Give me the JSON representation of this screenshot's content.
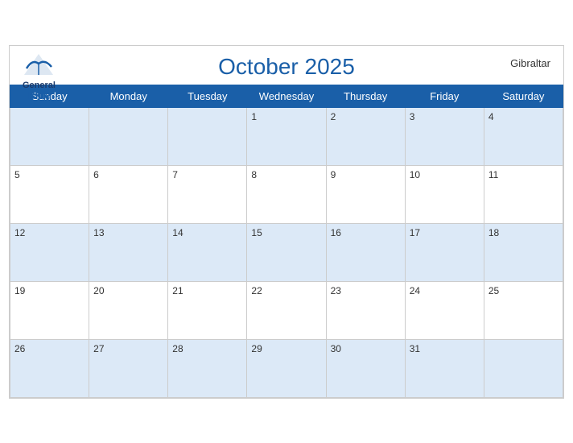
{
  "header": {
    "title": "October 2025",
    "country": "Gibraltar",
    "logo_general": "General",
    "logo_blue": "Blue"
  },
  "weekdays": [
    "Sunday",
    "Monday",
    "Tuesday",
    "Wednesday",
    "Thursday",
    "Friday",
    "Saturday"
  ],
  "weeks": [
    [
      "",
      "",
      "",
      "1",
      "2",
      "3",
      "4"
    ],
    [
      "5",
      "6",
      "7",
      "8",
      "9",
      "10",
      "11"
    ],
    [
      "12",
      "13",
      "14",
      "15",
      "16",
      "17",
      "18"
    ],
    [
      "19",
      "20",
      "21",
      "22",
      "23",
      "24",
      "25"
    ],
    [
      "26",
      "27",
      "28",
      "29",
      "30",
      "31",
      ""
    ]
  ]
}
